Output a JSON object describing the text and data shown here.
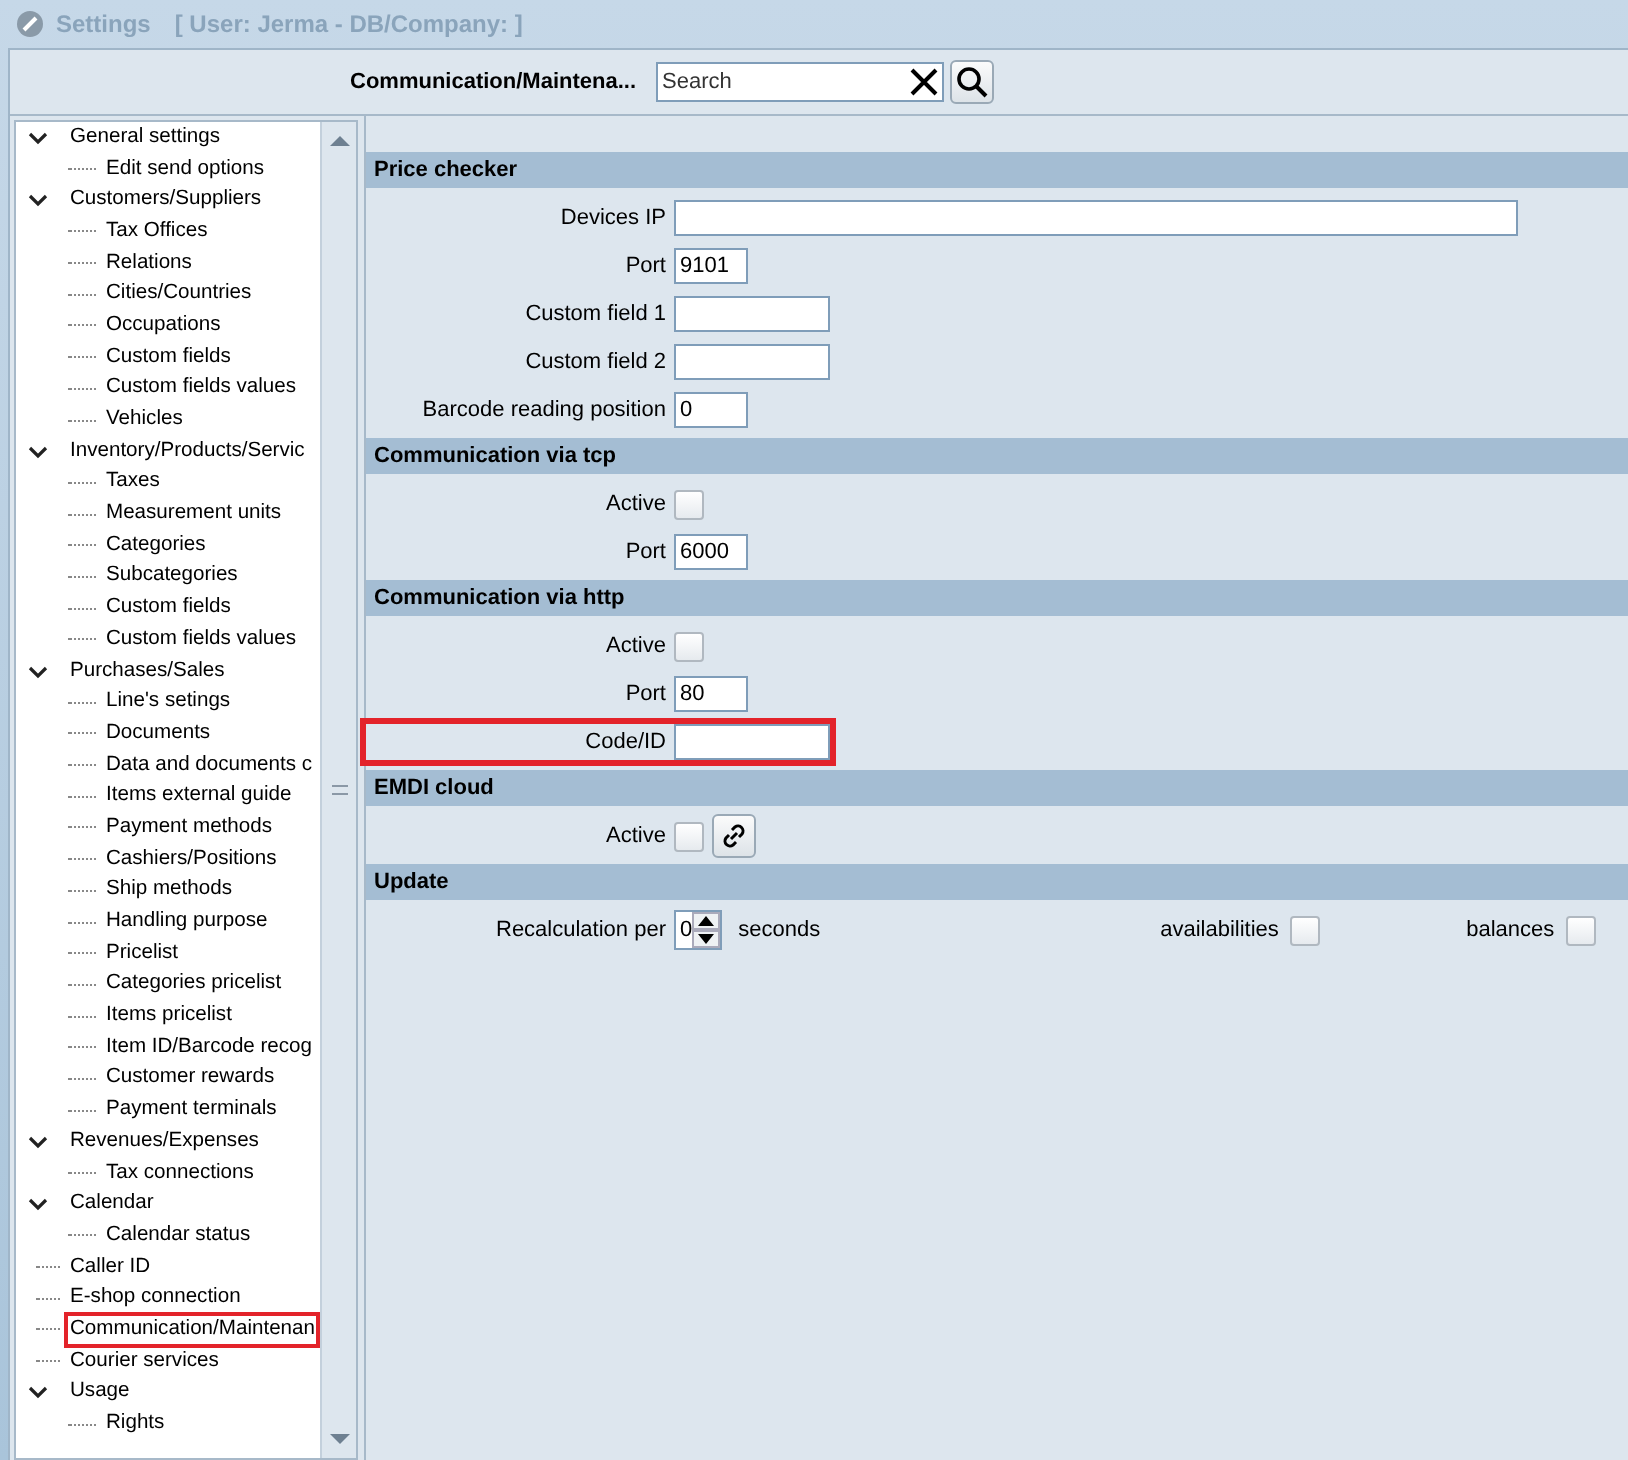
{
  "window": {
    "title": "Settings",
    "subtitle": "[ User: Jerma - DB/Company:  ]"
  },
  "header": {
    "breadcrumb": "Communication/Maintena...",
    "search": {
      "placeholder": "Search"
    }
  },
  "tree": [
    {
      "label": "General settings",
      "expanded": true,
      "highlighted": false,
      "children": [
        {
          "label": "Edit send options",
          "highlighted": false
        }
      ]
    },
    {
      "label": "Customers/Suppliers",
      "expanded": true,
      "highlighted": false,
      "children": [
        {
          "label": "Tax Offices",
          "highlighted": false
        },
        {
          "label": "Relations",
          "highlighted": false
        },
        {
          "label": "Cities/Countries",
          "highlighted": false
        },
        {
          "label": "Occupations",
          "highlighted": false
        },
        {
          "label": "Custom fields",
          "highlighted": false
        },
        {
          "label": "Custom fields values",
          "highlighted": false
        },
        {
          "label": "Vehicles",
          "highlighted": false
        }
      ]
    },
    {
      "label": "Inventory/Products/Servic",
      "expanded": true,
      "highlighted": false,
      "children": [
        {
          "label": "Taxes",
          "highlighted": false
        },
        {
          "label": "Measurement units",
          "highlighted": false
        },
        {
          "label": "Categories",
          "highlighted": false
        },
        {
          "label": "Subcategories",
          "highlighted": false
        },
        {
          "label": "Custom fields",
          "highlighted": false
        },
        {
          "label": "Custom fields values",
          "highlighted": false
        }
      ]
    },
    {
      "label": "Purchases/Sales",
      "expanded": true,
      "highlighted": false,
      "children": [
        {
          "label": "Line's setings",
          "highlighted": false
        },
        {
          "label": "Documents",
          "highlighted": false
        },
        {
          "label": "Data and documents c",
          "highlighted": false
        },
        {
          "label": "Items external guide",
          "highlighted": false
        },
        {
          "label": "Payment methods",
          "highlighted": false
        },
        {
          "label": "Cashiers/Positions",
          "highlighted": false
        },
        {
          "label": "Ship methods",
          "highlighted": false
        },
        {
          "label": "Handling purpose",
          "highlighted": false
        },
        {
          "label": "Pricelist",
          "highlighted": false
        },
        {
          "label": "Categories pricelist",
          "highlighted": false
        },
        {
          "label": "Items pricelist",
          "highlighted": false
        },
        {
          "label": "Item ID/Barcode recog",
          "highlighted": false
        },
        {
          "label": "Customer rewards",
          "highlighted": false
        },
        {
          "label": "Payment terminals",
          "highlighted": false
        }
      ]
    },
    {
      "label": "Revenues/Expenses",
      "expanded": true,
      "highlighted": false,
      "children": [
        {
          "label": "Tax connections",
          "highlighted": false
        }
      ]
    },
    {
      "label": "Calendar",
      "expanded": true,
      "highlighted": false,
      "children": [
        {
          "label": "Calendar status",
          "highlighted": false
        }
      ]
    },
    {
      "label": "Caller ID",
      "highlighted": false
    },
    {
      "label": "E-shop connection",
      "highlighted": false
    },
    {
      "label": "Communication/Maintenan",
      "highlighted": true
    },
    {
      "label": "Courier services",
      "highlighted": false
    },
    {
      "label": "Usage",
      "expanded": true,
      "highlighted": false,
      "children": [
        {
          "label": "Rights",
          "highlighted": false
        }
      ]
    }
  ],
  "sections": [
    {
      "title": "Price checker",
      "rows": [
        {
          "kind": "text",
          "label": "Devices IP",
          "value": "",
          "highlighted": false
        },
        {
          "kind": "text",
          "label": "Port",
          "value": "9101",
          "highlighted": false
        },
        {
          "kind": "text",
          "label": "Custom field 1",
          "value": "",
          "highlighted": false
        },
        {
          "kind": "text",
          "label": "Custom field 2",
          "value": "",
          "highlighted": false
        },
        {
          "kind": "text",
          "label": "Barcode reading position",
          "value": "0",
          "highlighted": false
        }
      ]
    },
    {
      "title": "Communication via tcp",
      "rows": [
        {
          "kind": "checkbox",
          "label": "Active",
          "checked": false
        },
        {
          "kind": "text",
          "label": "Port",
          "value": "6000",
          "highlighted": false
        }
      ]
    },
    {
      "title": "Communication via http",
      "rows": [
        {
          "kind": "checkbox",
          "label": "Active",
          "checked": false
        },
        {
          "kind": "text",
          "label": "Port",
          "value": "80",
          "highlighted": false
        },
        {
          "kind": "text",
          "label": "Code/ID",
          "value": "",
          "highlighted": true
        }
      ]
    },
    {
      "title": "EMDI cloud",
      "rows": [
        {
          "kind": "checkbox_link",
          "label": "Active",
          "checked": false
        }
      ]
    },
    {
      "title": "Update",
      "rows": [
        {
          "kind": "spinner",
          "label": "Recalculation per",
          "value": "0",
          "unit": "seconds",
          "options": [
            {
              "label": "availabilities",
              "checked": false
            },
            {
              "label": "balances",
              "checked": false
            }
          ]
        }
      ]
    }
  ]
}
